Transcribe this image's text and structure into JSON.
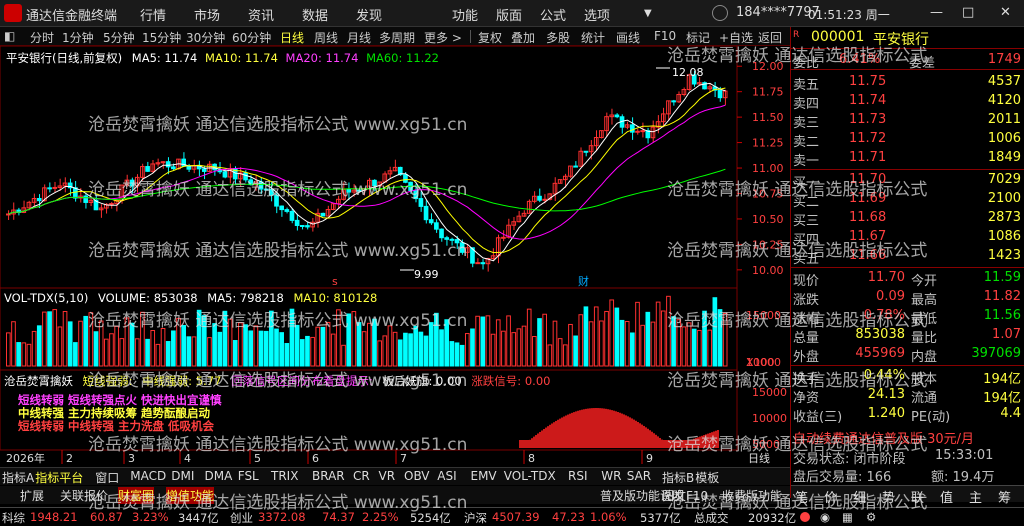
{
  "app": {
    "title": "通达信金融终端",
    "menus": [
      "行情",
      "市场",
      "资讯",
      "数据",
      "发现",
      "功能",
      "版面",
      "公式",
      "选项"
    ],
    "user": "184****7797",
    "time": "01:51:23 周一"
  },
  "toolbar": {
    "left": [
      "分时",
      "1分钟",
      "5分钟",
      "15分钟",
      "30分钟",
      "60分钟",
      "日线",
      "周线",
      "月线",
      "多周期",
      "更多 >"
    ],
    "right": [
      "复权",
      "叠加",
      "多股",
      "统计",
      "画线",
      "F10",
      "标记",
      "+自选",
      "返回"
    ]
  },
  "chart": {
    "legend_name": "平安银行(日线,前复权)",
    "ma5": "MA5: 11.74",
    "ma10": "MA10: 11.74",
    "ma20": "MA20: 11.74",
    "ma60": "MA60: 11.22",
    "price_ticks": [
      "12.00",
      "11.75",
      "11.50",
      "11.25",
      "11.00",
      "10.75",
      "10.50",
      "10.25",
      "10.00"
    ],
    "high_label": "12.08",
    "low_label": "9.99",
    "marker_s": "s",
    "marker_cai": "财",
    "vol_legend": "VOL-TDX(5,10)",
    "vol_value": "VOLUME: 853038",
    "vol_ma5": "MA5: 798218",
    "vol_ma10": "MA10: 810128",
    "vol_ticks": [
      "15000",
      "10000",
      "X100"
    ],
    "ind_name": "沧岳焚霄擒妖",
    "ind_a": "短线强弱:",
    "ind_b": "中线强弱: 5.77",
    "ind_c": "回落信号区间分布看盘提示:",
    "ind_d": "板后妖旗: 0.00",
    "ind_e": "涨跌信号: 0.00",
    "ind_text1": "短线转弱 短线转强点火 快进快出宜谨慎",
    "ind_text2": "中线转强 主力持续吸筹 趋势酝酿启动",
    "ind_text3": "短线转弱 中线转强 主力洗盘 低吸机会",
    "ind_ticks": [
      "15000",
      "10000",
      "5000"
    ],
    "year": "2026年",
    "months": [
      "2",
      "3",
      "4",
      "5",
      "6",
      "7",
      "8",
      "9"
    ],
    "period": "日线"
  },
  "quote": {
    "code": "000001",
    "name": "平安银行",
    "weibi_label": "委比",
    "weibi": "6.41%",
    "weicha_label": "委差",
    "weicha": "1749",
    "sells": [
      {
        "l": "卖五",
        "p": "11.75",
        "v": "4537"
      },
      {
        "l": "卖四",
        "p": "11.74",
        "v": "4120"
      },
      {
        "l": "卖三",
        "p": "11.73",
        "v": "2011"
      },
      {
        "l": "卖二",
        "p": "11.72",
        "v": "1006"
      },
      {
        "l": "卖一",
        "p": "11.71",
        "v": "1849"
      }
    ],
    "buys": [
      {
        "l": "买一",
        "p": "11.70",
        "v": "7029"
      },
      {
        "l": "买二",
        "p": "11.69",
        "v": "2100"
      },
      {
        "l": "买三",
        "p": "11.68",
        "v": "2873"
      },
      {
        "l": "买四",
        "p": "11.67",
        "v": "1086"
      },
      {
        "l": "买五",
        "p": "11.66",
        "v": "1423"
      }
    ],
    "stats": [
      [
        "现价",
        "11.70",
        "今开",
        "11.59"
      ],
      [
        "涨跌",
        "0.09",
        "最高",
        "11.82"
      ],
      [
        "涨幅",
        "0.78%",
        "最低",
        "11.56"
      ],
      [
        "总量",
        "853038",
        "量比",
        "1.07"
      ],
      [
        "外盘",
        "455969",
        "内盘",
        "397069"
      ]
    ],
    "stats2": [
      [
        "换手",
        "0.44%",
        "股本",
        "194亿"
      ],
      [
        "净资",
        "24.13",
        "流通",
        "194亿"
      ],
      [
        "收益(三)",
        "1.240",
        "PE(动)",
        "4.4"
      ]
    ],
    "promo": "自动续费通达信普及版 30元/月",
    "trade_status": "交易状态: 闭市阶段",
    "trade_time": "15:33:01",
    "last_vol": "盘后交易量: 166",
    "last_amt": "额: 19.4万"
  },
  "bottom_tabs1": [
    "指标A",
    "指标平台",
    "窗口",
    "MACD",
    "DMI",
    "DMA",
    "FSL",
    "TRIX",
    "BRAR",
    "CR",
    "VR",
    "OBV",
    "ASI",
    "EMV",
    "VOL-TDX",
    "RSI",
    "WR",
    "SAR",
    "指标B",
    "模板"
  ],
  "bottom_tabs2": [
    "扩展",
    "关联报价",
    "财富圈",
    "增值功能",
    "普及版功能说明",
    "图文F10",
    "收费版功能"
  ],
  "right_tabs": [
    "笔",
    "价",
    "细",
    "势",
    "联",
    "值",
    "主",
    "筹"
  ],
  "status": {
    "kechuang": "科综",
    "kc_val": "1948.21",
    "kc_chg": "60.87",
    "kc_pct": "3.23%",
    "kc_amt": "3447亿",
    "cy": "创业",
    "cy_val": "3372.08",
    "cy_chg": "74.37",
    "cy_pct": "2.25%",
    "cy_amt": "5254亿",
    "hs": "沪深",
    "hs_val": "4507.39",
    "hs_chg": "47.23",
    "hs_pct": "1.06%",
    "hs_amt": "5377亿",
    "cx": "总成交",
    "cx_amt": "20932亿"
  },
  "watermark": [
    "沧岳焚霄擒妖 通达信选股指标公式 www.xg51.cn",
    "沧岳焚霄擒妖 通达信选股指标公式"
  ],
  "colors": {
    "up": "#ff3030",
    "down": "#00ffff",
    "ma5": "#ffffff",
    "ma10": "#ffff00",
    "ma20": "#ff00ff",
    "ma60": "#00ff00",
    "grid": "#7a0000"
  }
}
